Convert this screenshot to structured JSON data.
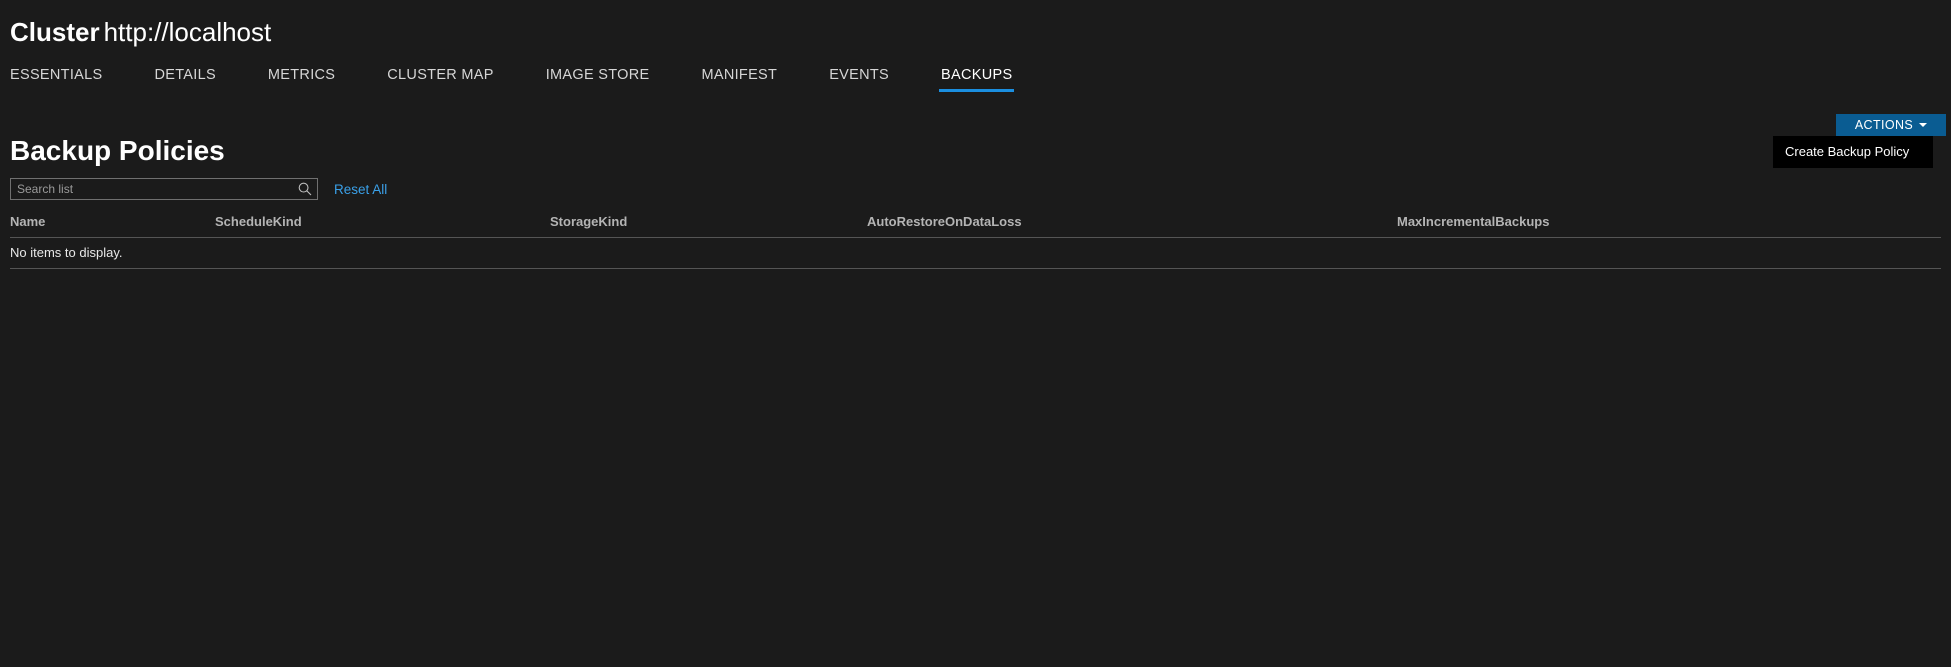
{
  "header": {
    "entity_type": "Cluster",
    "entity_url": "http://localhost"
  },
  "tabs": [
    {
      "label": "ESSENTIALS",
      "active": false
    },
    {
      "label": "DETAILS",
      "active": false
    },
    {
      "label": "METRICS",
      "active": false
    },
    {
      "label": "CLUSTER MAP",
      "active": false
    },
    {
      "label": "IMAGE STORE",
      "active": false
    },
    {
      "label": "MANIFEST",
      "active": false
    },
    {
      "label": "EVENTS",
      "active": false
    },
    {
      "label": "BACKUPS",
      "active": true
    }
  ],
  "actions": {
    "button_label": "ACTIONS",
    "caret_icon": "chevron-down-icon",
    "menu_items": [
      {
        "label": "Create Backup Policy"
      }
    ]
  },
  "main": {
    "section_title": "Backup Policies",
    "search": {
      "placeholder": "Search list",
      "value": "",
      "icon": "search-icon"
    },
    "reset_label": "Reset All",
    "table": {
      "columns": [
        "Name",
        "ScheduleKind",
        "StorageKind",
        "AutoRestoreOnDataLoss",
        "MaxIncrementalBackups"
      ],
      "rows": [],
      "empty_message": "No items to display."
    }
  },
  "colors": {
    "background": "#1b1b1b",
    "accent_blue": "#1b8fe0",
    "button_blue": "#0a5c92",
    "link_blue": "#3aa0e8",
    "menu_background": "#000000",
    "divider": "#555555"
  }
}
